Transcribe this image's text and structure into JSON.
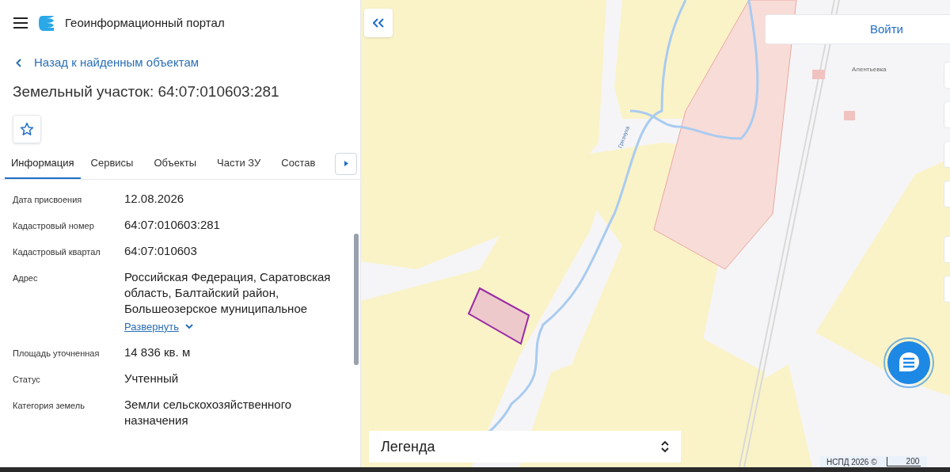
{
  "header": {
    "title": "Геоинформационный портал"
  },
  "back_link": "Назад к найденным объектам",
  "object_title": "Земельный участок: 64:07:010603:281",
  "favorite": {
    "selected": false
  },
  "tabs": [
    {
      "label": "Информация",
      "selected": true
    },
    {
      "label": "Сервисы",
      "selected": false
    },
    {
      "label": "Объекты",
      "selected": false
    },
    {
      "label": "Части ЗУ",
      "selected": false
    },
    {
      "label": "Состав",
      "selected": false
    }
  ],
  "fields": [
    {
      "label": "Дата присвоения",
      "value": "12.08.2026"
    },
    {
      "label": "Кадастровый номер",
      "value": "64:07:010603:281"
    },
    {
      "label": "Кадастровый квартал",
      "value": "64:07:010603"
    },
    {
      "label": "Адрес",
      "value": "Российская Федерация, Саратовская область, Балтайский район, Большеозерское муниципальное",
      "expand_link": "Развернуть"
    },
    {
      "label": "Площадь уточненная",
      "value": "14 836 кв. м"
    },
    {
      "label": "Статус",
      "value": "Учтенный"
    },
    {
      "label": "Категория земель",
      "value": "Земли сельскохозяйственного назначения"
    }
  ],
  "map": {
    "login_button": "Войти",
    "place_labels": [
      "Алентьевка"
    ],
    "river_labels": [
      "Грязнуха"
    ],
    "legend": "Легенда",
    "attribution": "НСПД 2026 ©",
    "scale": "200"
  }
}
